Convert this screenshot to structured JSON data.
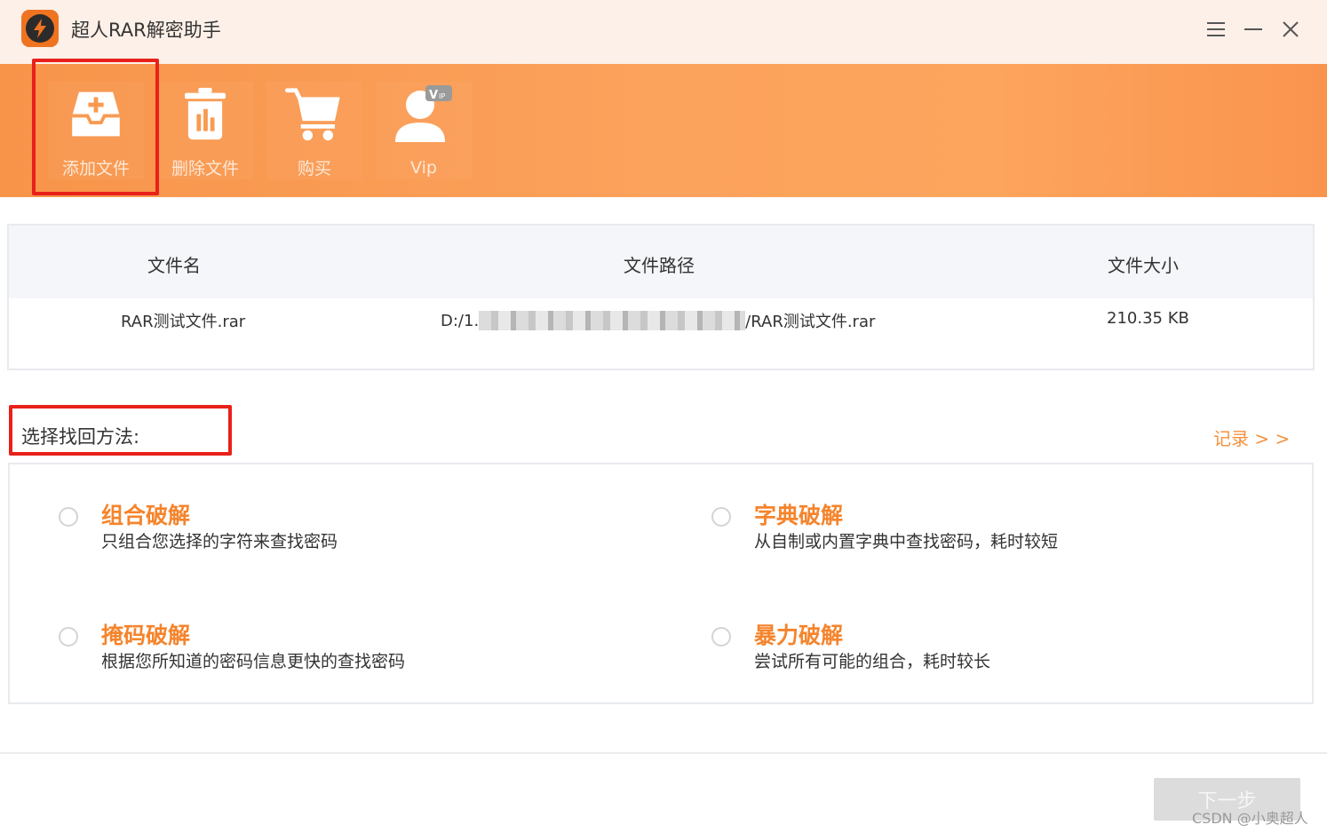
{
  "window": {
    "title": "超人RAR解密助手",
    "controls": [
      "menu-icon",
      "minimize-icon",
      "close-icon"
    ]
  },
  "toolbar": {
    "items": [
      {
        "label": "添加文件",
        "icon": "add-file-icon"
      },
      {
        "label": "删除文件",
        "icon": "trash-icon"
      },
      {
        "label": "购买",
        "icon": "cart-icon"
      },
      {
        "label": "Vip",
        "icon": "vip-user-icon"
      }
    ]
  },
  "file_table": {
    "headers": [
      "文件名",
      "文件路径",
      "文件大小"
    ],
    "rows": [
      {
        "name": "RAR测试文件.rar",
        "path_prefix": "D:/1.",
        "path_suffix": "/RAR测试文件.rar",
        "size": "210.35 KB"
      }
    ]
  },
  "methods_section": {
    "label": "选择找回方法:",
    "record_link": "记录 > >",
    "methods": [
      {
        "title": "组合破解",
        "desc": "只组合您选择的字符来查找密码"
      },
      {
        "title": "字典破解",
        "desc": "从自制或内置字典中查找密码，耗时较短"
      },
      {
        "title": "掩码破解",
        "desc": "根据您所知道的密码信息更快的查找密码"
      },
      {
        "title": "暴力破解",
        "desc": "尝试所有可能的组合，耗时较长"
      }
    ]
  },
  "footer": {
    "next_label": "下一步",
    "watermark": "CSDN @小奥超人"
  },
  "colors": {
    "accent": "#f5842c",
    "toolbar_start": "#f8944a",
    "toolbar_end": "#fda45d",
    "highlight": "#e8211a",
    "titlebar_bg": "#fdf0e8"
  }
}
